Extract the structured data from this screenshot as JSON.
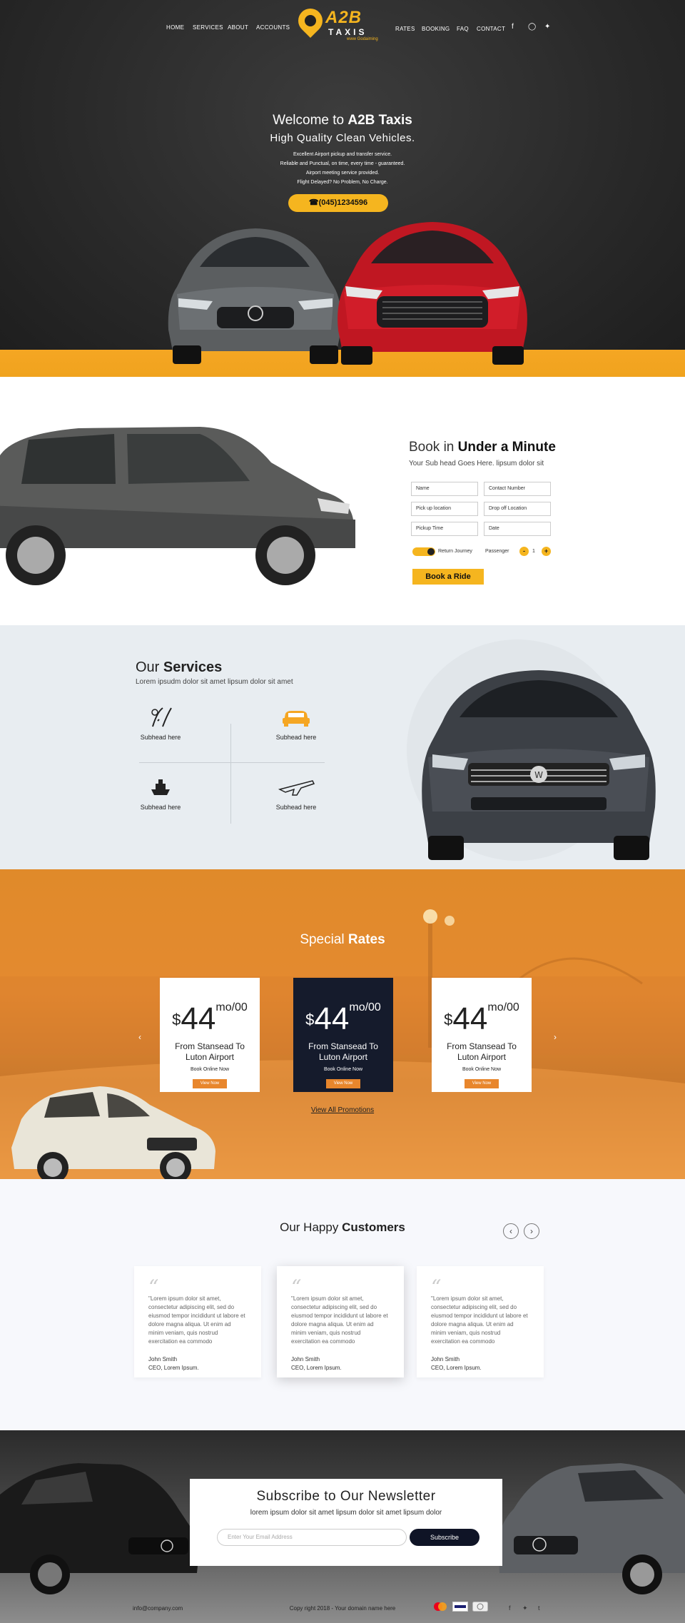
{
  "nav": {
    "left": [
      "HOME",
      "SERVICES",
      "ABOUT",
      "ACCOUNTS"
    ],
    "right": [
      "RATES",
      "BOOKING",
      "FAQ",
      "CONTACT"
    ]
  },
  "logo": {
    "brand": "A2B",
    "sub": "TAXIS",
    "tag": "www Godaiming"
  },
  "hero": {
    "title_pre": "Welcome to ",
    "title_bold": "A2B Taxis",
    "subtitle": "High Quality Clean Vehicles.",
    "lines": [
      "Excellent Airport pickup and transfer service.",
      "Reliable and Punctual, on time, every time - guaranteed.",
      "Airport meeting service provided.",
      "Flight Delayed? No Problem, No Charge."
    ],
    "phone": "(045)1234596"
  },
  "book": {
    "title_pre": "Book in ",
    "title_bold": "Under a Minute",
    "sub": "Your Sub head Goes Here. lipsum dolor sit",
    "fields": {
      "name": "Name",
      "contact": "Contact Number",
      "pickup": "Pick up location",
      "dropoff": "Drop off Location",
      "time": "Pickup Time",
      "date": "Date"
    },
    "return": "Return Journey",
    "passenger": "Passenger",
    "passenger_count": "1",
    "button": "Book a Ride"
  },
  "services": {
    "title_pre": "Our ",
    "title_bold": "Services",
    "sub": "Lorem ipsudm dolor sit amet lipsum dolor sit amet",
    "items": [
      "Subhead here",
      "Subhead here",
      "Subhead here",
      "Subhead here"
    ]
  },
  "rates": {
    "title_pre": "Special ",
    "title_bold": "Rates",
    "cards": [
      {
        "currency": "$",
        "amount": "44",
        "unit": "mo/00",
        "route": "From Stansead  To Luton Airport",
        "online": "Book Online Now",
        "button": "View Now"
      },
      {
        "currency": "$",
        "amount": "44",
        "unit": "mo/00",
        "route": "From Stansead  To Luton Airport",
        "online": "Book Online Now",
        "button": "View Now"
      },
      {
        "currency": "$",
        "amount": "44",
        "unit": "mo/00",
        "route": "From Stansead  To Luton Airport",
        "online": "Book Online Now",
        "button": "View Now"
      }
    ],
    "view_all": "View All Promotions"
  },
  "customers": {
    "title_pre": "Our Happy ",
    "title_bold": "Customers",
    "testimonials": [
      {
        "text": "\"Lorem ipsum dolor sit amet, consectetur adipiscing elit, sed do eiusmod tempor incididunt ut labore et dolore magna aliqua. Ut enim ad minim veniam, quis nostrud exercitation ea commodo",
        "name": "John Smith",
        "role": "CEO, Lorem Ipsum."
      },
      {
        "text": "\"Lorem ipsum dolor sit amet, consectetur adipiscing elit, sed do eiusmod tempor incididunt ut labore et dolore magna aliqua. Ut enim ad minim veniam, quis nostrud exercitation ea commodo",
        "name": "John Smith",
        "role": "CEO, Lorem Ipsum."
      },
      {
        "text": "\"Lorem ipsum dolor sit amet, consectetur adipiscing elit, sed do eiusmod tempor incididunt ut labore et dolore magna aliqua. Ut enim ad minim veniam, quis nostrud exercitation ea commodo",
        "name": "John Smith",
        "role": "CEO, Lorem Ipsum."
      }
    ]
  },
  "newsletter": {
    "title": "Subscribe to Our Newsletter",
    "sub": "lorem ipsum dolor sit amet lipsum dolor sit amet lipsum dolor",
    "placeholder": "Enter Your Email Address",
    "button": "Subscribe"
  },
  "footer": {
    "email": "info@company.com",
    "copyright": "Copy right 2018 - Your domain name here"
  },
  "colors": {
    "accent": "#f5b51f",
    "orange": "#e8862c",
    "navy": "#0f1426"
  }
}
